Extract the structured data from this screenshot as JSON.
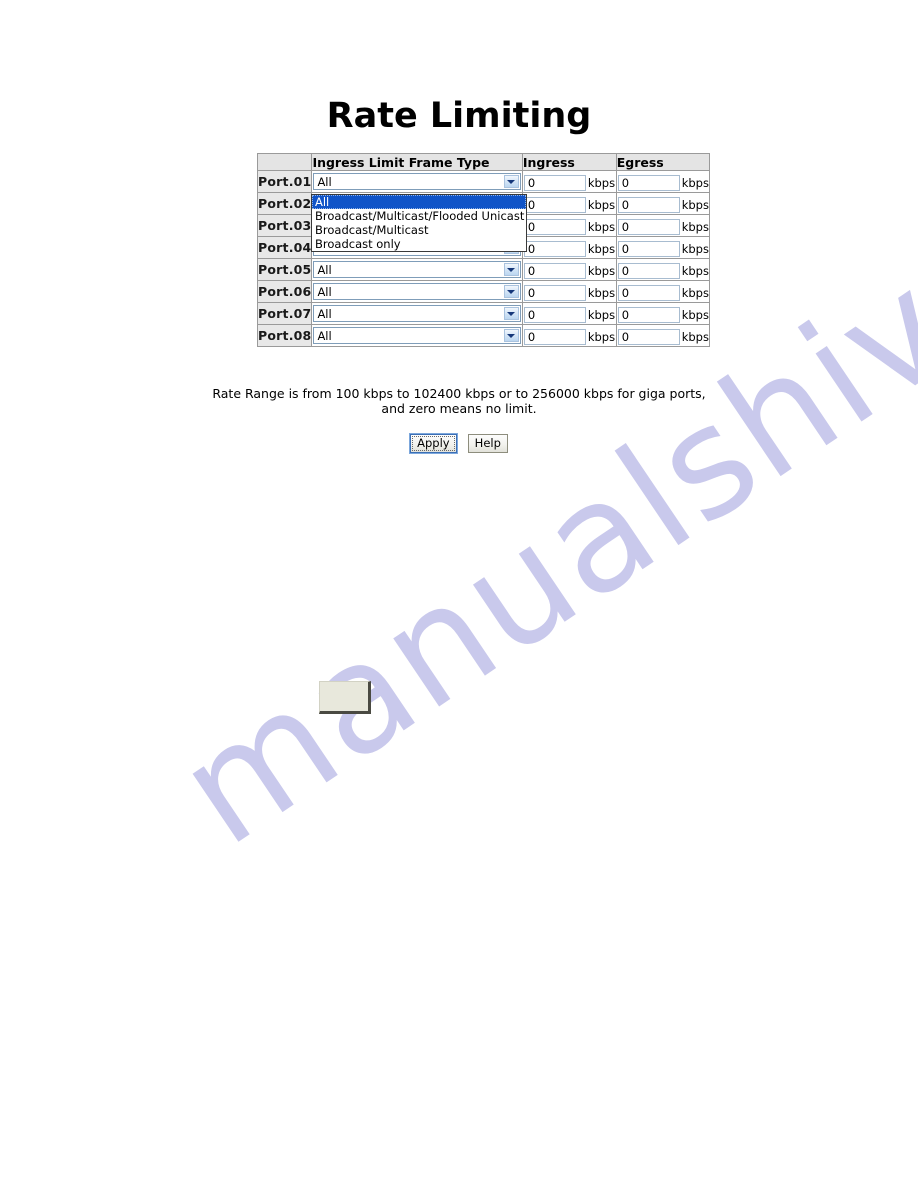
{
  "page": {
    "title": "Rate Limiting",
    "note_line1": "Rate Range is from 100 kbps to 102400 kbps or to 256000 kbps for giga ports,",
    "note_line2": "and zero means no limit."
  },
  "table": {
    "headers": {
      "port": "",
      "frame_type": "Ingress Limit Frame Type",
      "ingress": "Ingress",
      "egress": "Egress"
    },
    "unit": "kbps",
    "rows": [
      {
        "port": "Port.01",
        "frame_type": "All",
        "ingress": "0",
        "egress": "0"
      },
      {
        "port": "Port.02",
        "frame_type": "All",
        "ingress": "0",
        "egress": "0"
      },
      {
        "port": "Port.03",
        "frame_type": "All",
        "ingress": "0",
        "egress": "0"
      },
      {
        "port": "Port.04",
        "frame_type": "All",
        "ingress": "0",
        "egress": "0"
      },
      {
        "port": "Port.05",
        "frame_type": "All",
        "ingress": "0",
        "egress": "0"
      },
      {
        "port": "Port.06",
        "frame_type": "All",
        "ingress": "0",
        "egress": "0"
      },
      {
        "port": "Port.07",
        "frame_type": "All",
        "ingress": "0",
        "egress": "0"
      },
      {
        "port": "Port.08",
        "frame_type": "All",
        "ingress": "0",
        "egress": "0"
      }
    ]
  },
  "dropdown": {
    "open": true,
    "open_for_row": "Port.01",
    "selected": "All",
    "options": [
      "All",
      "Broadcast/Multicast/Flooded Unicast",
      "Broadcast/Multicast",
      "Broadcast only"
    ]
  },
  "buttons": {
    "apply": "Apply",
    "help": "Help"
  },
  "watermark": {
    "text": "manualshive.com"
  },
  "colors": {
    "header_bg": "#e4e4e4",
    "port_bg": "#e8e8e8",
    "table_border": "#9a9a9a",
    "select_border": "#7f9db9",
    "option_selected_bg": "#1054c8",
    "watermark": "#c9c9ec",
    "page_bg": "#ffffff"
  }
}
